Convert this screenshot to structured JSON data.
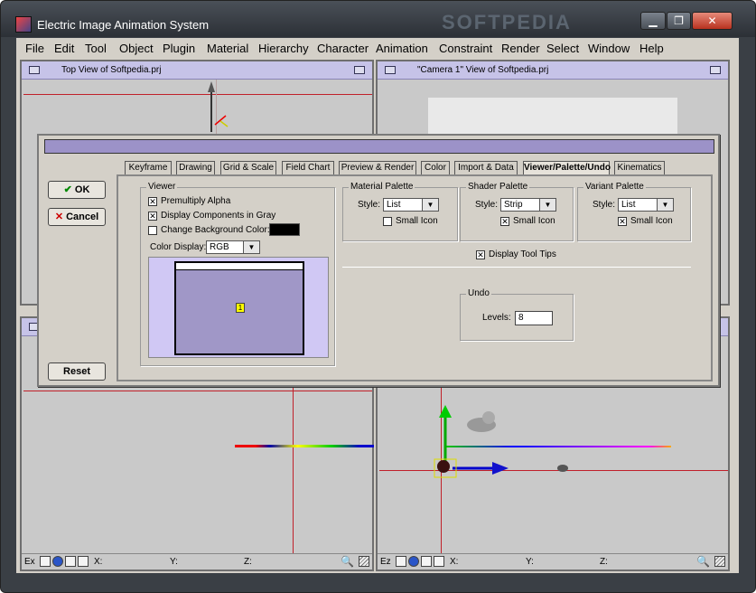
{
  "window": {
    "title": "Electric Image Animation System",
    "watermark": "SOFTPEDIA",
    "controls": {
      "minimize": "▁",
      "maximize": "❐",
      "close": "✕"
    }
  },
  "menu": [
    "File",
    "Edit",
    "Tool",
    "Object",
    "Plugin",
    "Material",
    "Hierarchy",
    "Character",
    "Animation",
    "Constraint",
    "Render",
    "Select",
    "Window",
    "Help"
  ],
  "viewports": {
    "top": {
      "title": "Top View of Softpedia.prj"
    },
    "camera": {
      "title": "\"Camera 1\" View of Softpedia.prj"
    },
    "bottom_left": {
      "axis": "Ex",
      "coords": {
        "x": "X:",
        "y": "Y:",
        "z": "Z:"
      }
    },
    "bottom_right": {
      "axis": "Ez",
      "coords": {
        "x": "X:",
        "y": "Y:",
        "z": "Z:"
      }
    }
  },
  "dialog": {
    "buttons": {
      "ok": "OK",
      "cancel": "Cancel",
      "reset": "Reset"
    },
    "tabs": [
      "Keyframe",
      "Drawing",
      "Grid & Scale",
      "Field Chart",
      "Preview & Render",
      "Color",
      "Import & Data",
      "Viewer/Palette/Undo",
      "Kinematics"
    ],
    "active_tab": "Viewer/Palette/Undo",
    "viewer": {
      "label": "Viewer",
      "premultiply": {
        "label": "Premultiply Alpha",
        "checked": true
      },
      "display_gray": {
        "label": "Display Components in Gray",
        "checked": true
      },
      "change_bg": {
        "label": "Change Background Color:",
        "checked": false
      },
      "color_display_label": "Color Display:",
      "color_display_value": "RGB",
      "preview_badge": "1"
    },
    "material_palette": {
      "label": "Material Palette",
      "style_label": "Style:",
      "style_value": "List",
      "small_icon": {
        "label": "Small Icon",
        "checked": false
      }
    },
    "shader_palette": {
      "label": "Shader Palette",
      "style_label": "Style:",
      "style_value": "Strip",
      "small_icon": {
        "label": "Small Icon",
        "checked": true
      }
    },
    "variant_palette": {
      "label": "Variant Palette",
      "style_label": "Style:",
      "style_value": "List",
      "small_icon": {
        "label": "Small Icon",
        "checked": true
      }
    },
    "display_tool_tips": {
      "label": "Display Tool Tips",
      "checked": true
    },
    "undo": {
      "label": "Undo",
      "levels_label": "Levels:",
      "levels_value": "8"
    }
  },
  "colors": {
    "accent": "#9c92c8",
    "viewport_title": "#c6c3e8"
  }
}
